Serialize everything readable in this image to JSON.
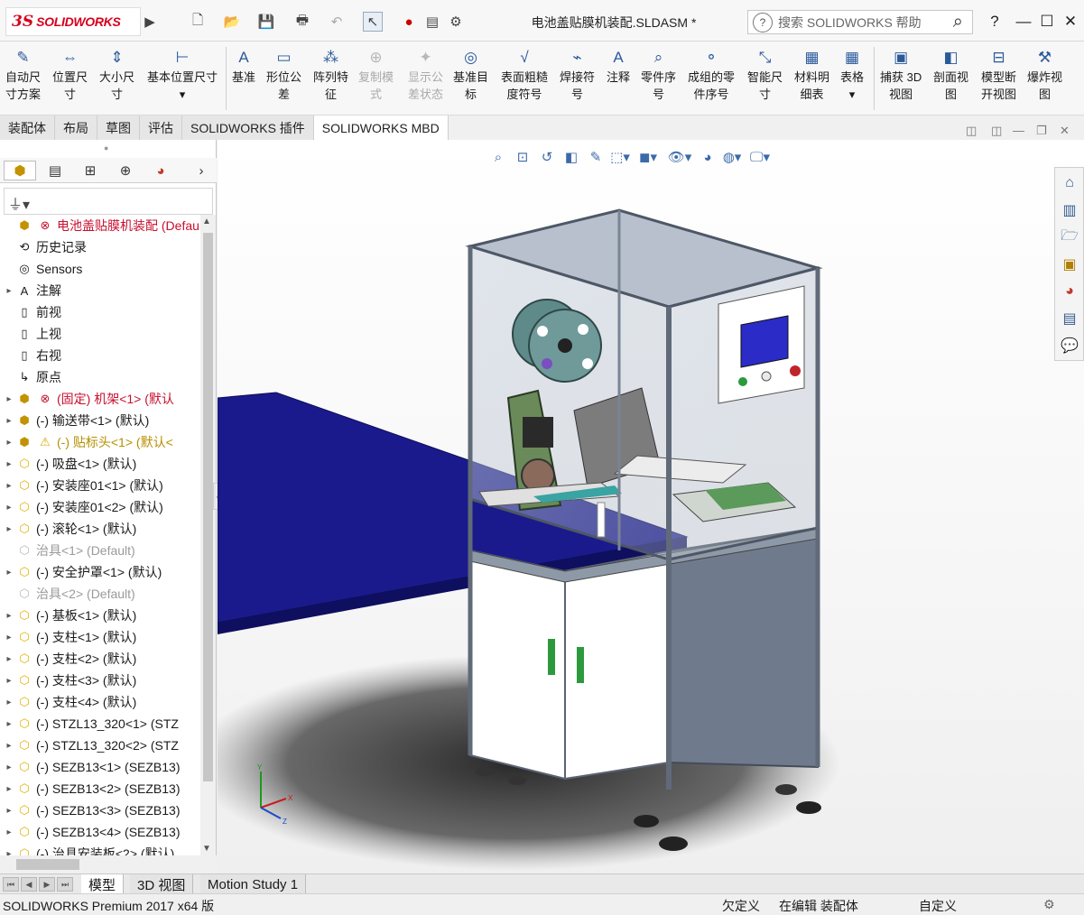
{
  "app": {
    "logo_ds": "3S",
    "logo_text": "SOLIDWORKS",
    "doc_title": "电池盖贴膜机装配.SLDASM *"
  },
  "search": {
    "placeholder": "搜索 SOLIDWORKS 帮助",
    "help_icon": "question-circle-icon"
  },
  "titlebar": {
    "help": "?",
    "minimize": "—",
    "restore": "☐",
    "close": "✕"
  },
  "ribbon": [
    {
      "l1": "自动尺",
      "l2": "寸方案",
      "icon": "auto-dimension-icon",
      "glyph": "✎",
      "enabled": true
    },
    {
      "l1": "位置尺",
      "l2": "寸",
      "icon": "location-dimension-icon",
      "glyph": "⇔",
      "enabled": true
    },
    {
      "l1": "大小尺",
      "l2": "寸",
      "icon": "size-dimension-icon",
      "glyph": "⇕",
      "enabled": true
    },
    {
      "l1": "基本位置尺寸",
      "l2": "▾",
      "icon": "basic-location-dimension-icon",
      "glyph": "⊢",
      "enabled": true
    },
    {
      "l1": "基准",
      "l2": "",
      "icon": "datum-icon",
      "glyph": "A",
      "enabled": true
    },
    {
      "l1": "形位公",
      "l2": "差",
      "icon": "geometric-tolerance-icon",
      "glyph": "▭",
      "enabled": true
    },
    {
      "l1": "阵列特",
      "l2": "征",
      "icon": "pattern-feature-icon",
      "glyph": "⁂",
      "enabled": true
    },
    {
      "l1": "复制模",
      "l2": "式",
      "icon": "copy-scheme-icon",
      "glyph": "⊕",
      "enabled": false
    },
    {
      "l1": "显示公",
      "l2": "差状态",
      "icon": "show-tolerance-status-icon",
      "glyph": "✦",
      "enabled": false
    },
    {
      "l1": "基准目",
      "l2": "标",
      "icon": "datum-target-icon",
      "glyph": "◎",
      "enabled": true
    },
    {
      "l1": "表面粗糙",
      "l2": "度符号",
      "icon": "surface-finish-icon",
      "glyph": "√",
      "enabled": true
    },
    {
      "l1": "焊接符",
      "l2": "号",
      "icon": "weld-symbol-icon",
      "glyph": "⌁",
      "enabled": true
    },
    {
      "l1": "注释",
      "l2": "",
      "icon": "note-icon",
      "glyph": "A",
      "enabled": true
    },
    {
      "l1": "零件序",
      "l2": "号",
      "icon": "balloon-icon",
      "glyph": "⌕",
      "enabled": true
    },
    {
      "l1": "成组的零",
      "l2": "件序号",
      "icon": "stacked-balloon-icon",
      "glyph": "⚬",
      "enabled": true
    },
    {
      "l1": "智能尺",
      "l2": "寸",
      "icon": "smart-dimension-icon",
      "glyph": "⤡",
      "enabled": true
    },
    {
      "l1": "材料明",
      "l2": "细表",
      "icon": "bill-of-materials-icon",
      "glyph": "▦",
      "enabled": true
    },
    {
      "l1": "表格",
      "l2": "▾",
      "icon": "table-icon",
      "glyph": "▦",
      "enabled": true
    },
    {
      "l1": "捕获 3D",
      "l2": "视图",
      "icon": "capture-3d-view-icon",
      "glyph": "▣",
      "enabled": true
    },
    {
      "l1": "剖面视",
      "l2": "图",
      "icon": "section-view-icon",
      "glyph": "◧",
      "enabled": true
    },
    {
      "l1": "模型断",
      "l2": "开视图",
      "icon": "model-break-view-icon",
      "glyph": "⊟",
      "enabled": true
    },
    {
      "l1": "爆炸视",
      "l2": "图",
      "icon": "exploded-view-icon",
      "glyph": "⚒",
      "enabled": true
    }
  ],
  "tabs": [
    "装配体",
    "布局",
    "草图",
    "评估",
    "SOLIDWORKS 插件",
    "SOLIDWORKS MBD"
  ],
  "active_tab": "SOLIDWORKS MBD",
  "tree": [
    {
      "label": "电池盖贴膜机装配  (Defau",
      "icon": "assembly-icon",
      "status": "error-root",
      "arrow": ""
    },
    {
      "label": "历史记录",
      "icon": "history-icon",
      "status": "normal",
      "arrow": ""
    },
    {
      "label": "Sensors",
      "icon": "sensors-icon",
      "status": "normal",
      "arrow": ""
    },
    {
      "label": "注解",
      "icon": "annotations-icon",
      "status": "normal",
      "arrow": "▸"
    },
    {
      "label": "前视",
      "icon": "plane-icon",
      "status": "normal",
      "arrow": ""
    },
    {
      "label": "上视",
      "icon": "plane-icon",
      "status": "normal",
      "arrow": ""
    },
    {
      "label": "右视",
      "icon": "plane-icon",
      "status": "normal",
      "arrow": ""
    },
    {
      "label": "原点",
      "icon": "origin-icon",
      "status": "normal",
      "arrow": ""
    },
    {
      "label": "(固定) 机架<1> (默认",
      "icon": "subassembly-icon",
      "status": "error",
      "arrow": "▸"
    },
    {
      "label": "(-) 输送带<1> (默认)",
      "icon": "subassembly-icon",
      "status": "normal",
      "arrow": "▸"
    },
    {
      "label": "(-) 贴标头<1> (默认<",
      "icon": "subassembly-icon",
      "status": "warning",
      "arrow": "▸"
    },
    {
      "label": "(-) 吸盘<1> (默认)",
      "icon": "part-icon",
      "status": "normal",
      "arrow": "▸"
    },
    {
      "label": "(-) 安装座01<1> (默认)",
      "icon": "part-icon",
      "status": "normal",
      "arrow": "▸"
    },
    {
      "label": "(-) 安装座01<2> (默认)",
      "icon": "part-icon",
      "status": "normal",
      "arrow": "▸"
    },
    {
      "label": "(-) 滚轮<1> (默认)",
      "icon": "part-icon",
      "status": "normal",
      "arrow": "▸"
    },
    {
      "label": "治具<1> (Default)",
      "icon": "part-icon",
      "status": "suppressed",
      "arrow": ""
    },
    {
      "label": "(-) 安全护罩<1> (默认)",
      "icon": "part-icon",
      "status": "normal",
      "arrow": "▸"
    },
    {
      "label": "治具<2> (Default)",
      "icon": "part-icon",
      "status": "suppressed",
      "arrow": ""
    },
    {
      "label": "(-) 基板<1> (默认)",
      "icon": "part-icon",
      "status": "normal",
      "arrow": "▸"
    },
    {
      "label": "(-) 支柱<1> (默认)",
      "icon": "part-icon",
      "status": "normal",
      "arrow": "▸"
    },
    {
      "label": "(-) 支柱<2> (默认)",
      "icon": "part-icon",
      "status": "normal",
      "arrow": "▸"
    },
    {
      "label": "(-) 支柱<3> (默认)",
      "icon": "part-icon",
      "status": "normal",
      "arrow": "▸"
    },
    {
      "label": "(-) 支柱<4> (默认)",
      "icon": "part-icon",
      "status": "normal",
      "arrow": "▸"
    },
    {
      "label": "(-) STZL13_320<1> (STZ",
      "icon": "part-icon",
      "status": "normal",
      "arrow": "▸"
    },
    {
      "label": "(-) STZL13_320<2> (STZ",
      "icon": "part-icon",
      "status": "normal",
      "arrow": "▸"
    },
    {
      "label": "(-) SEZB13<1> (SEZB13)",
      "icon": "part-icon",
      "status": "normal",
      "arrow": "▸"
    },
    {
      "label": "(-) SEZB13<2> (SEZB13)",
      "icon": "part-icon",
      "status": "normal",
      "arrow": "▸"
    },
    {
      "label": "(-) SEZB13<3> (SEZB13)",
      "icon": "part-icon",
      "status": "normal",
      "arrow": "▸"
    },
    {
      "label": "(-) SEZB13<4> (SEZB13)",
      "icon": "part-icon",
      "status": "normal",
      "arrow": "▸"
    },
    {
      "label": "(-) 治具安装板<2> (默认)",
      "icon": "part-icon",
      "status": "normal",
      "arrow": "▸"
    }
  ],
  "bottom_tabs": [
    "模型",
    "3D 视图",
    "Motion Study 1"
  ],
  "active_bottom_tab": "模型",
  "status": {
    "product": "SOLIDWORKS Premium 2017 x64 版",
    "underdefined": "欠定义",
    "editing": "在编辑 装配体",
    "custom": "自定义"
  },
  "colors": {
    "brand": "#d6001c",
    "conveyor_base": "#1a1a8c",
    "machine_frame": "#8a97a8",
    "accent_blue": "#2a5a9a",
    "error": "#c8102e",
    "warning": "#b58f00"
  }
}
